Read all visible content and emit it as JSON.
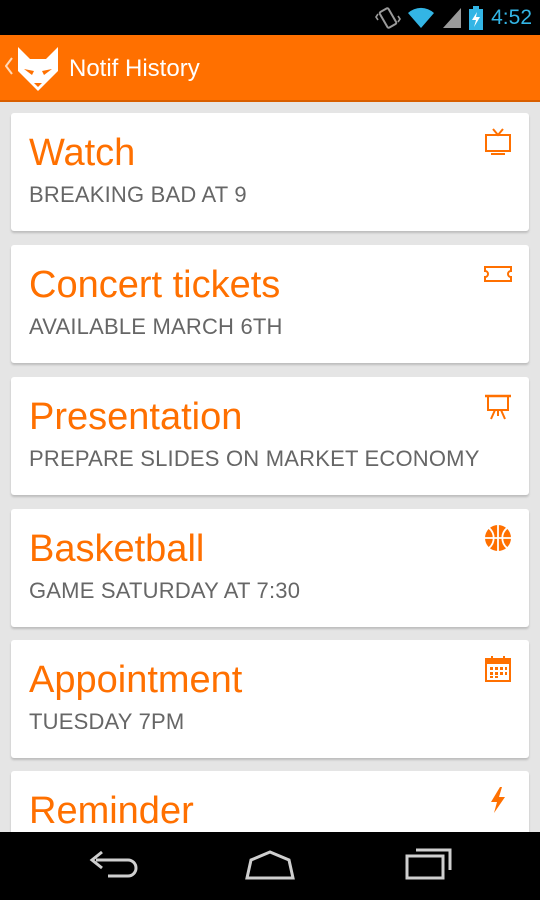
{
  "status_bar": {
    "time": "4:52",
    "icons": [
      "vibrate-icon",
      "wifi-icon",
      "signal-icon",
      "battery-charging-icon"
    ],
    "color": "#33b5e5"
  },
  "app_bar": {
    "title": "Notif History",
    "color": "#ff7000",
    "logo_icon": "fox-logo-icon"
  },
  "notifications": [
    {
      "title": "Watch",
      "subtitle": "BREAKING BAD AT 9",
      "icon": "tv-icon"
    },
    {
      "title": "Concert tickets",
      "subtitle": "AVAILABLE MARCH 6TH",
      "icon": "ticket-icon"
    },
    {
      "title": "Presentation",
      "subtitle": "PREPARE SLIDES ON MARKET ECONOMY",
      "icon": "presentation-icon"
    },
    {
      "title": "Basketball",
      "subtitle": "GAME SATURDAY AT 7:30",
      "icon": "basketball-icon"
    },
    {
      "title": "Appointment",
      "subtitle": "TUESDAY 7PM",
      "icon": "calendar-icon"
    },
    {
      "title": "Reminder",
      "subtitle": "",
      "icon": "lightning-icon"
    }
  ],
  "nav_bar": {
    "buttons": [
      "back-icon",
      "home-icon",
      "recents-icon"
    ]
  }
}
